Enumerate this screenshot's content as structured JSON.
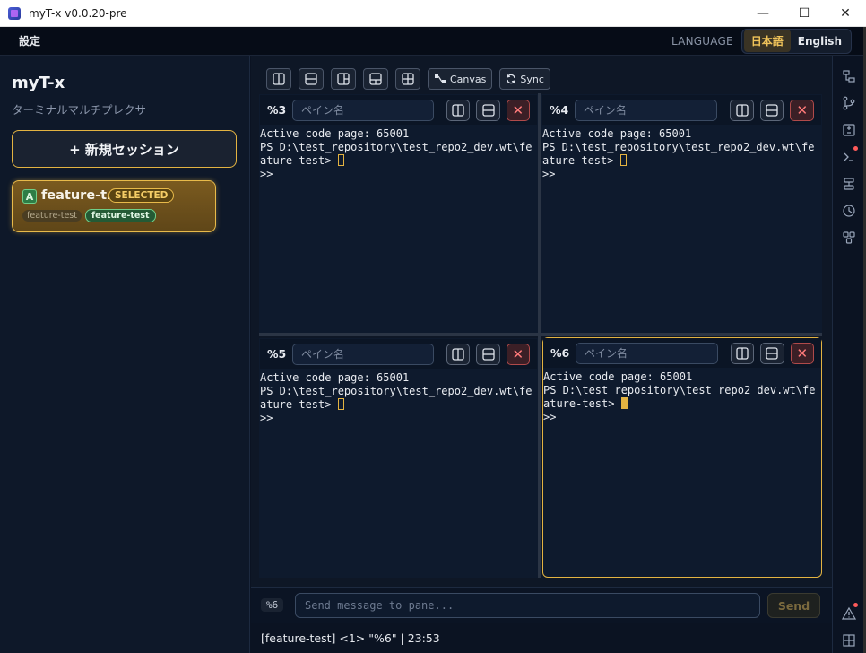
{
  "window": {
    "title": "myT-x v0.0.20-pre",
    "minimize": "—",
    "maximize": "☐",
    "close": "✕"
  },
  "menu": {
    "settings": "設定",
    "language_label": "LANGUAGE",
    "lang_ja": "日本語",
    "lang_en": "English"
  },
  "sidebar": {
    "brand": "myT-x",
    "subtitle": "ターミナルマルチプレクサ",
    "new_session": "+ 新規セッション",
    "session": {
      "badge": "A",
      "name": "feature-t...",
      "selected": "SELECTED",
      "tag1": "feature-test",
      "tag2": "feature-test"
    }
  },
  "toolbar": {
    "canvas": "Canvas",
    "sync": "Sync"
  },
  "panes": [
    {
      "id": "%3",
      "name_placeholder": "ペイン名",
      "lines": [
        "Active code page: 65001",
        "PS D:\\test_repository\\test_repo2_dev.wt\\fe",
        "ature-test> "
      ],
      "prompt2": ">>",
      "active": false
    },
    {
      "id": "%4",
      "name_placeholder": "ペイン名",
      "lines": [
        "Active code page: 65001",
        "PS D:\\test_repository\\test_repo2_dev.wt\\fe",
        "ature-test> "
      ],
      "prompt2": ">>",
      "active": false
    },
    {
      "id": "%5",
      "name_placeholder": "ペイン名",
      "lines": [
        "Active code page: 65001",
        "PS D:\\test_repository\\test_repo2_dev.wt\\fe",
        "ature-test> "
      ],
      "prompt2": ">>",
      "active": false
    },
    {
      "id": "%6",
      "name_placeholder": "ペイン名",
      "lines": [
        "Active code page: 65001",
        "PS D:\\test_repository\\test_repo2_dev.wt\\fe",
        "ature-test> "
      ],
      "prompt2": ">>",
      "active": true
    }
  ],
  "send": {
    "target": "%6",
    "placeholder": "Send message to pane...",
    "button": "Send"
  },
  "status": "[feature-test] <1> \"%6\" | 23:53",
  "colors": {
    "accent": "#e3b341",
    "bg": "#0e1726",
    "close": "#ff7a7a"
  }
}
